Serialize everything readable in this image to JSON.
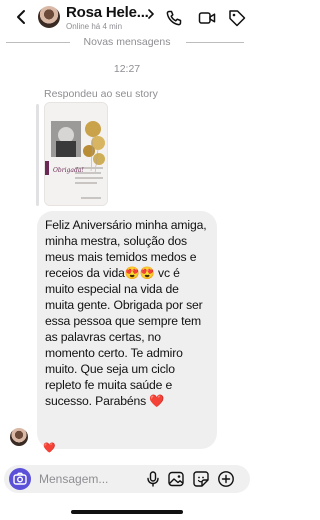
{
  "header": {
    "contact_name": "Rosa Hele...",
    "status": "Online há 4 min"
  },
  "thread": {
    "new_messages_label": "Novas mensagens",
    "timestamp": "12:27",
    "story_reply_label": "Respondeu ao seu story",
    "story_caption": "Obrigada!",
    "message_text": "Feliz Aniversário minha amiga, minha mestra, solução dos meus mais temidos medos e receios da vida😍😍 vc é muito especial na vida de muita gente. Obrigada por ser essa pessoa que sempre tem as palavras certas, no momento certo. Te admiro muito. Que seja um ciclo repleto fe muita saúde e sucesso. Parabéns ❤️",
    "reaction": "❤️"
  },
  "composer": {
    "placeholder": "Mensagem..."
  },
  "colors": {
    "accent": "#5b51d8",
    "bubble": "#efefef",
    "muted_text": "#8e8e93"
  }
}
